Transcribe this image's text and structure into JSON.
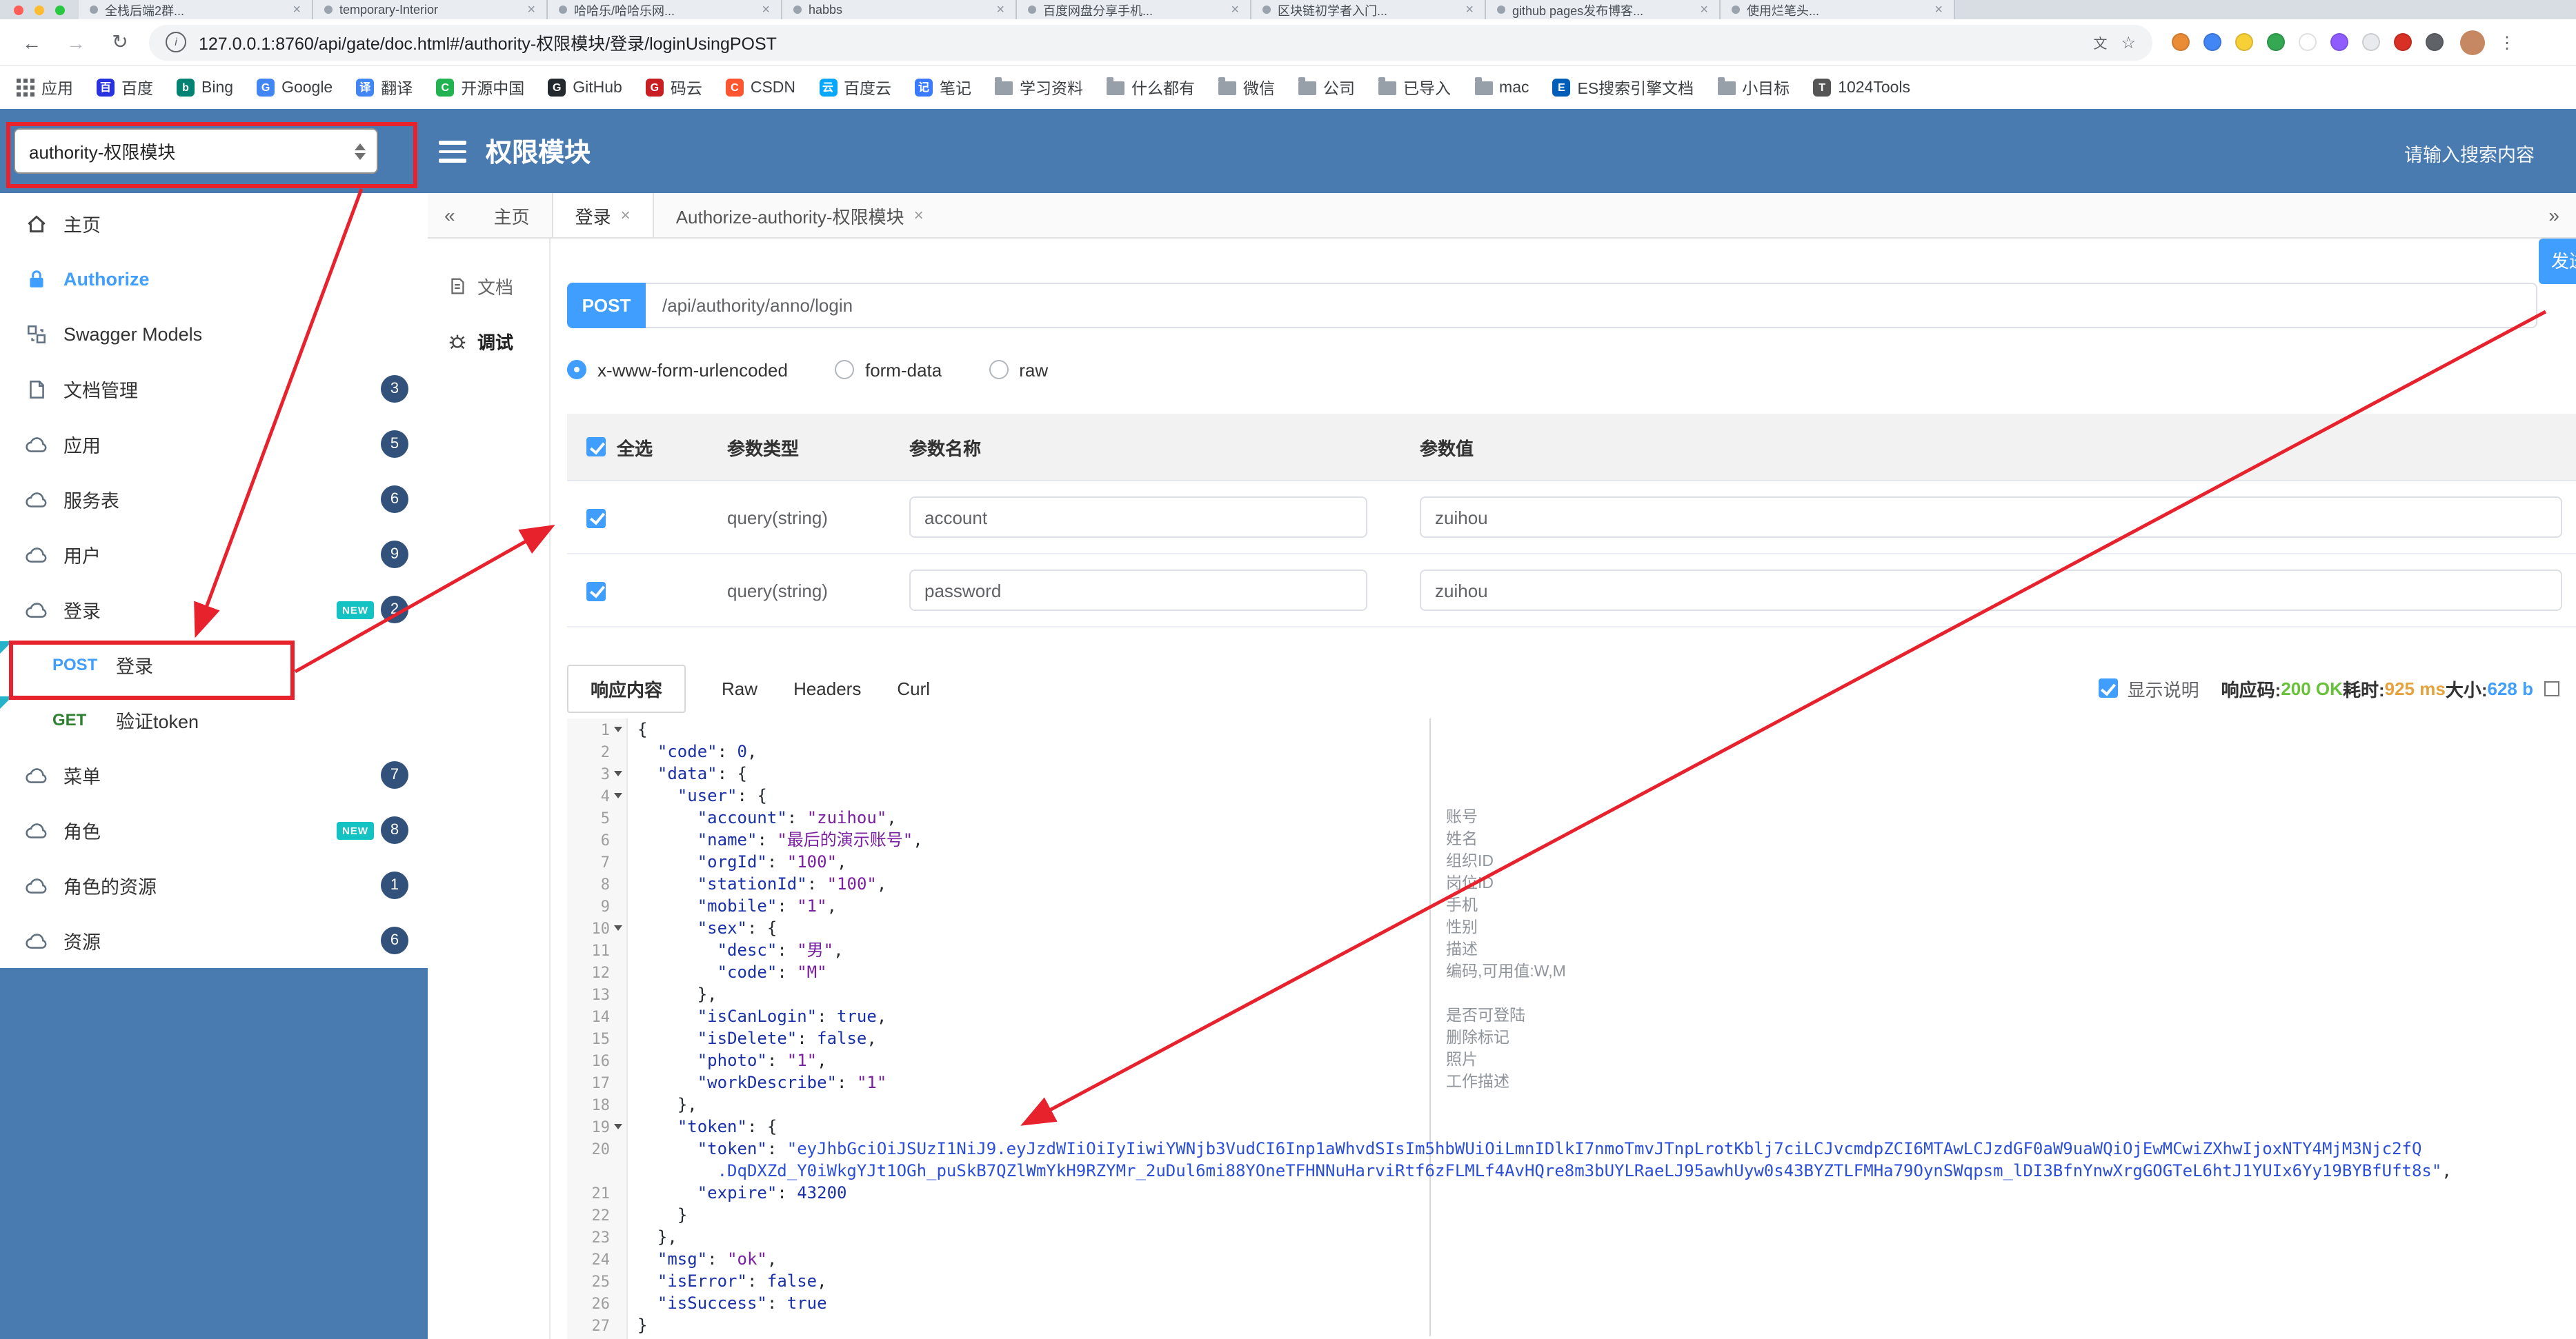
{
  "colors": {
    "accent": "#409EFF",
    "header": "#4a7bb0",
    "badge": "#32517b",
    "new_tag": "#13c2c2",
    "get_text": "#2f8132",
    "annotation_red": "#e8222d",
    "status_ok": "#67c23a",
    "status_time": "#e6a23c",
    "status_size": "#409EFF"
  },
  "icons": {
    "collapse": "«",
    "expand": "»",
    "close": "×",
    "back": "←",
    "forward": "→",
    "reload": "↻",
    "menu_dots": "⋮",
    "star": "☆",
    "info": "i",
    "translate": "文"
  },
  "browser": {
    "tabs": [
      "全栈后端2群...",
      "temporary-Interior",
      "哈哈乐/哈哈乐网...",
      "habbs",
      "百度网盘分享手机...",
      "区块链初学者入门...",
      "github pages发布博客...",
      "使用烂笔头..."
    ],
    "url": "127.0.0.1:8760/api/gate/doc.html#/authority-权限模块/登录/loginUsingPOST",
    "bookmarks": [
      {
        "label": "应用",
        "icon": "apps-icon"
      },
      {
        "label": "百度",
        "icon": "baidu-icon",
        "color": "#2932e1",
        "letter": "百"
      },
      {
        "label": "Bing",
        "icon": "bing-icon",
        "color": "#008373",
        "letter": "b"
      },
      {
        "label": "Google",
        "icon": "google-icon",
        "color": "#4285f4",
        "letter": "G"
      },
      {
        "label": "翻译",
        "icon": "translate-bookmark-icon",
        "color": "#4285f4",
        "letter": "译"
      },
      {
        "label": "开源中国",
        "icon": "oschina-icon",
        "color": "#21b351",
        "letter": "C"
      },
      {
        "label": "GitHub",
        "icon": "github-icon",
        "color": "#24292e",
        "letter": "G"
      },
      {
        "label": "码云",
        "icon": "gitee-icon",
        "color": "#c71d23",
        "letter": "G"
      },
      {
        "label": "CSDN",
        "icon": "csdn-icon",
        "color": "#fc5531",
        "letter": "C"
      },
      {
        "label": "百度云",
        "icon": "baidu-cloud-icon",
        "color": "#06a7ff",
        "letter": "云"
      },
      {
        "label": "笔记",
        "icon": "note-icon",
        "color": "#3a7afe",
        "letter": "记"
      },
      {
        "label": "学习资料",
        "icon": "folder-icon"
      },
      {
        "label": "什么都有",
        "icon": "folder-icon"
      },
      {
        "label": "微信",
        "icon": "folder-icon"
      },
      {
        "label": "公司",
        "icon": "folder-icon"
      },
      {
        "label": "已导入",
        "icon": "folder-icon"
      },
      {
        "label": "mac",
        "icon": "folder-icon"
      },
      {
        "label": "ES搜索引擎文档",
        "icon": "es-doc-icon",
        "color": "#005eb8",
        "letter": "E"
      },
      {
        "label": "小目标",
        "icon": "folder-icon"
      },
      {
        "label": "1024Tools",
        "icon": "tools-icon",
        "color": "#555555",
        "letter": "T"
      }
    ],
    "ext_icons": [
      {
        "name": "extension-icon-1",
        "color": "#ea8b35"
      },
      {
        "name": "extension-icon-2",
        "color": "#4285f4"
      },
      {
        "name": "extension-icon-3",
        "color": "#f7d038"
      },
      {
        "name": "extension-icon-4",
        "color": "#34a853"
      },
      {
        "name": "extension-icon-5",
        "color": "#ffffff"
      },
      {
        "name": "extension-icon-6",
        "color": "#8f5cff"
      },
      {
        "name": "extension-icon-7",
        "color": "#e8eaed"
      },
      {
        "name": "extension-icon-8",
        "color": "#d93025"
      },
      {
        "name": "extension-icon-9",
        "color": "#5f6368"
      }
    ]
  },
  "header": {
    "service": "authority-权限模块",
    "title": "权限模块",
    "search": "请输入搜索内容"
  },
  "sidebar": {
    "new_label": "NEW",
    "items": [
      {
        "label": "主页"
      },
      {
        "label": "Authorize"
      },
      {
        "label": "Swagger Models"
      },
      {
        "label": "文档管理",
        "badge": "3"
      },
      {
        "label": "应用",
        "badge": "5"
      },
      {
        "label": "服务表",
        "badge": "6"
      },
      {
        "label": "用户",
        "badge": "9"
      },
      {
        "label": "登录",
        "badge": "2",
        "is_new": true
      },
      {
        "label": "菜单",
        "badge": "7"
      },
      {
        "label": "角色",
        "badge": "8",
        "is_new": true
      },
      {
        "label": "角色的资源",
        "badge": "1"
      },
      {
        "label": "资源",
        "badge": "6"
      }
    ],
    "sub": [
      {
        "method": "POST",
        "label": "登录"
      },
      {
        "method": "GET",
        "label": "验证token"
      }
    ]
  },
  "content": {
    "tabs": [
      {
        "label": "主页"
      },
      {
        "label": "登录",
        "active": true
      },
      {
        "label": "Authorize-authority-权限模块"
      }
    ],
    "doc_nav": [
      {
        "label": "文档"
      },
      {
        "label": "调试",
        "active": true
      }
    ]
  },
  "debug": {
    "method": "POST",
    "url": "/api/authority/anno/login",
    "send_label": "发送",
    "body_types": [
      "x-www-form-urlencoded",
      "form-data",
      "raw"
    ],
    "body_type_selected": "x-www-form-urlencoded",
    "table": {
      "headers": [
        "全选",
        "参数类型",
        "参数名称",
        "参数值"
      ],
      "rows": [
        {
          "checked": true,
          "type": "query(string)",
          "name": "account",
          "value": "zuihou"
        },
        {
          "checked": true,
          "type": "query(string)",
          "name": "password",
          "value": "zuihou"
        }
      ]
    }
  },
  "response": {
    "tabs": [
      "响应内容",
      "Raw",
      "Headers",
      "Curl"
    ],
    "active_tab": "响应内容",
    "show_desc": "显示说明",
    "meta": {
      "code_label": "响应码:",
      "code": "200 OK",
      "time_label": "耗时:",
      "time": "925 ms",
      "size_label": "大小:",
      "size": "628 b"
    }
  },
  "code": {
    "lines": [
      {
        "n": "1",
        "fold": true,
        "seg": [
          [
            "p",
            "{"
          ]
        ]
      },
      {
        "n": "2",
        "seg": [
          [
            "w",
            "  "
          ],
          [
            "k",
            "\"code\""
          ],
          [
            "p",
            ": "
          ],
          [
            "n",
            "0"
          ],
          [
            "p",
            ","
          ]
        ]
      },
      {
        "n": "3",
        "fold": true,
        "seg": [
          [
            "w",
            "  "
          ],
          [
            "k",
            "\"data\""
          ],
          [
            "p",
            ": {"
          ]
        ]
      },
      {
        "n": "4",
        "fold": true,
        "seg": [
          [
            "w",
            "    "
          ],
          [
            "k",
            "\"user\""
          ],
          [
            "p",
            ": {"
          ]
        ]
      },
      {
        "n": "5",
        "seg": [
          [
            "w",
            "      "
          ],
          [
            "k",
            "\"account\""
          ],
          [
            "p",
            ": "
          ],
          [
            "s",
            "\"zuihou\""
          ],
          [
            "p",
            ","
          ]
        ]
      },
      {
        "n": "6",
        "seg": [
          [
            "w",
            "      "
          ],
          [
            "k",
            "\"name\""
          ],
          [
            "p",
            ": "
          ],
          [
            "s",
            "\"最后的演示账号\""
          ],
          [
            "p",
            ","
          ]
        ]
      },
      {
        "n": "7",
        "seg": [
          [
            "w",
            "      "
          ],
          [
            "k",
            "\"orgId\""
          ],
          [
            "p",
            ": "
          ],
          [
            "s",
            "\"100\""
          ],
          [
            "p",
            ","
          ]
        ]
      },
      {
        "n": "8",
        "seg": [
          [
            "w",
            "      "
          ],
          [
            "k",
            "\"stationId\""
          ],
          [
            "p",
            ": "
          ],
          [
            "s",
            "\"100\""
          ],
          [
            "p",
            ","
          ]
        ]
      },
      {
        "n": "9",
        "seg": [
          [
            "w",
            "      "
          ],
          [
            "k",
            "\"mobile\""
          ],
          [
            "p",
            ": "
          ],
          [
            "s",
            "\"1\""
          ],
          [
            "p",
            ","
          ]
        ]
      },
      {
        "n": "10",
        "fold": true,
        "seg": [
          [
            "w",
            "      "
          ],
          [
            "k",
            "\"sex\""
          ],
          [
            "p",
            ": {"
          ]
        ]
      },
      {
        "n": "11",
        "seg": [
          [
            "w",
            "        "
          ],
          [
            "k",
            "\"desc\""
          ],
          [
            "p",
            ": "
          ],
          [
            "s",
            "\"男\""
          ],
          [
            "p",
            ","
          ]
        ]
      },
      {
        "n": "12",
        "seg": [
          [
            "w",
            "        "
          ],
          [
            "k",
            "\"code\""
          ],
          [
            "p",
            ": "
          ],
          [
            "s",
            "\"M\""
          ]
        ]
      },
      {
        "n": "13",
        "seg": [
          [
            "w",
            "      "
          ],
          [
            "p",
            "},"
          ]
        ]
      },
      {
        "n": "14",
        "seg": [
          [
            "w",
            "      "
          ],
          [
            "k",
            "\"isCanLogin\""
          ],
          [
            "p",
            ": "
          ],
          [
            "b",
            "true"
          ],
          [
            "p",
            ","
          ]
        ]
      },
      {
        "n": "15",
        "seg": [
          [
            "w",
            "      "
          ],
          [
            "k",
            "\"isDelete\""
          ],
          [
            "p",
            ": "
          ],
          [
            "b",
            "false"
          ],
          [
            "p",
            ","
          ]
        ]
      },
      {
        "n": "16",
        "seg": [
          [
            "w",
            "      "
          ],
          [
            "k",
            "\"photo\""
          ],
          [
            "p",
            ": "
          ],
          [
            "s",
            "\"1\""
          ],
          [
            "p",
            ","
          ]
        ]
      },
      {
        "n": "17",
        "seg": [
          [
            "w",
            "      "
          ],
          [
            "k",
            "\"workDescribe\""
          ],
          [
            "p",
            ": "
          ],
          [
            "s",
            "\"1\""
          ]
        ]
      },
      {
        "n": "18",
        "seg": [
          [
            "w",
            "    "
          ],
          [
            "p",
            "},"
          ]
        ]
      },
      {
        "n": "19",
        "fold": true,
        "seg": [
          [
            "w",
            "    "
          ],
          [
            "k",
            "\"token\""
          ],
          [
            "p",
            ": {"
          ]
        ]
      },
      {
        "n": "20",
        "seg": [
          [
            "w",
            "      "
          ],
          [
            "k",
            "\"token\""
          ],
          [
            "p",
            ": "
          ],
          [
            "t",
            "\"eyJhbGciOiJSUzI1NiJ9.eyJzdWIiOiIyIiwiYWNjb3VudCI6Inp1aWhvdSIsIm5hbWUiOiLmnIDlkI7nmoTmvJTnpLrotKblj7ciLCJvcmdpZCI6MTAwLCJzdGF0aW9uaWQiOjEwMCwiZXhwIjoxNTY4MjM3Njc2fQ"
          ]
        ]
      },
      {
        "n": "",
        "seg": [
          [
            "w",
            "        "
          ],
          [
            "t",
            ".DqDXZd_Y0iWkgYJt1OGh_puSkB7QZlWmYkH9RZYMr_2uDul6mi88YOneTFHNNuHarviRtf6zFLMLf4AvHQre8m3bUYLRaeLJ95awhUyw0s43BYZTLFMHa79OynSWqpsm_lDI3BfnYnwXrgGOGTeL6htJ1YUIx6Yy19BYBfUft8s\""
          ],
          [
            "p",
            ","
          ]
        ]
      },
      {
        "n": "21",
        "seg": [
          [
            "w",
            "      "
          ],
          [
            "k",
            "\"expire\""
          ],
          [
            "p",
            ": "
          ],
          [
            "n",
            "43200"
          ]
        ]
      },
      {
        "n": "22",
        "seg": [
          [
            "w",
            "    "
          ],
          [
            "p",
            "}"
          ]
        ]
      },
      {
        "n": "23",
        "seg": [
          [
            "w",
            "  "
          ],
          [
            "p",
            "},"
          ]
        ]
      },
      {
        "n": "24",
        "seg": [
          [
            "w",
            "  "
          ],
          [
            "k",
            "\"msg\""
          ],
          [
            "p",
            ": "
          ],
          [
            "s",
            "\"ok\""
          ],
          [
            "p",
            ","
          ]
        ]
      },
      {
        "n": "25",
        "seg": [
          [
            "w",
            "  "
          ],
          [
            "k",
            "\"isError\""
          ],
          [
            "p",
            ": "
          ],
          [
            "b",
            "false"
          ],
          [
            "p",
            ","
          ]
        ]
      },
      {
        "n": "26",
        "seg": [
          [
            "w",
            "  "
          ],
          [
            "k",
            "\"isSuccess\""
          ],
          [
            "p",
            ": "
          ],
          [
            "b",
            "true"
          ]
        ]
      },
      {
        "n": "27",
        "seg": [
          [
            "p",
            "}"
          ]
        ]
      }
    ],
    "annotations": [
      {
        "line": 5,
        "text": "账号"
      },
      {
        "line": 6,
        "text": "姓名"
      },
      {
        "line": 7,
        "text": "组织ID"
      },
      {
        "line": 8,
        "text": "岗位ID"
      },
      {
        "line": 9,
        "text": "手机"
      },
      {
        "line": 10,
        "text": "性别"
      },
      {
        "line": 11,
        "text": "描述"
      },
      {
        "line": 12,
        "text": "编码,可用值:W,M"
      },
      {
        "line": 14,
        "text": "是否可登陆"
      },
      {
        "line": 15,
        "text": "删除标记"
      },
      {
        "line": 16,
        "text": "照片"
      },
      {
        "line": 17,
        "text": "工作描述"
      }
    ]
  }
}
